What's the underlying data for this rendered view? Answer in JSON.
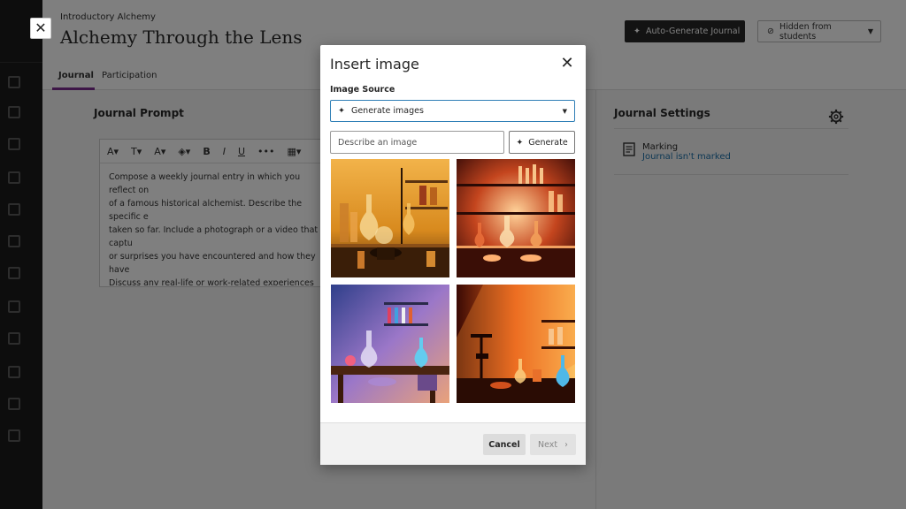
{
  "page": {
    "course": "Introductory Alchemy",
    "title": "Alchemy Through the Lens",
    "auto_generate_label": "Auto-Generate Journal",
    "visibility_label": "Hidden from students",
    "tabs": [
      {
        "label": "Journal",
        "active": true
      },
      {
        "label": "Participation",
        "active": false
      }
    ],
    "journal_prompt": {
      "title": "Journal Prompt",
      "body": "Compose a weekly journal entry in which you reflect on\nof a famous historical alchemist. Describe the specific e\ntaken so far. Include a photograph or a video that captu\nor surprises you have encountered and how they have\nDiscuss any real-life or work-related experiences that ha\nhow your work in the laboratory aligns with the broade\nsomething unique."
    },
    "journal_settings": {
      "title": "Journal Settings",
      "marking_label": "Marking",
      "marking_value": "Journal isn't marked"
    }
  },
  "modal": {
    "title": "Insert image",
    "source_label": "Image Source",
    "source_value": "Generate images",
    "describe_placeholder": "Describe an image",
    "generate_label": "Generate",
    "cancel_label": "Cancel",
    "next_label": "Next"
  },
  "colors": {
    "accent": "#7b2c8f",
    "focus": "#2f7fb6",
    "link": "#1a6fa8"
  }
}
